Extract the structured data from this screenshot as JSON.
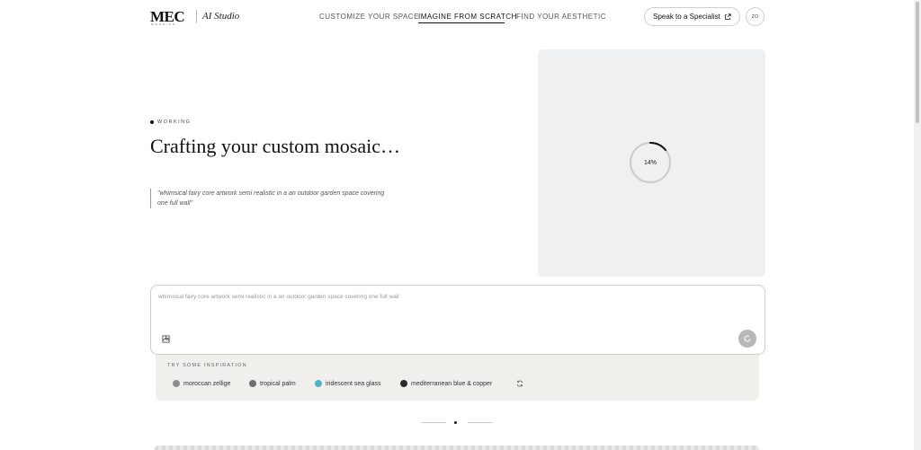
{
  "header": {
    "logo": "MEC",
    "logo_sub": "MOSAICS",
    "studio": "AI Studio",
    "nav": [
      {
        "label": "CUSTOMIZE YOUR SPACE"
      },
      {
        "label": "IMAGINE FROM SCRATCH",
        "active": true
      },
      {
        "label": "FIND YOUR AESTHETIC"
      }
    ],
    "specialist_label": "Speak to a Specialist",
    "avatar_initials": "ZO"
  },
  "main": {
    "status": "WORKING",
    "headline": "Crafting your custom mosaic…",
    "quote": "\"whimsical fairy core artwork semi realistic in a an outdoor garden space covering one full wall\""
  },
  "preview": {
    "progress_label": "14%",
    "progress_fraction": 0.14
  },
  "prompt": {
    "text": "whimsical fairy core artwork semi realistic in a an outdoor garden space covering one full wall"
  },
  "inspiration": {
    "title": "TRY SOME INSPIRATION",
    "chips": [
      {
        "label": "moroccan zellige",
        "color": "#8f8f8f"
      },
      {
        "label": "tropical palm",
        "color": "#6e6e6e"
      },
      {
        "label": "iridescent sea glass",
        "color": "#4fb3c8"
      },
      {
        "label": "mediterranean blue & copper",
        "color": "#2a2a2a"
      }
    ]
  },
  "colors": {
    "accent": "#111111",
    "panel": "#eef0f1",
    "inspo_bg": "#f0efec"
  }
}
